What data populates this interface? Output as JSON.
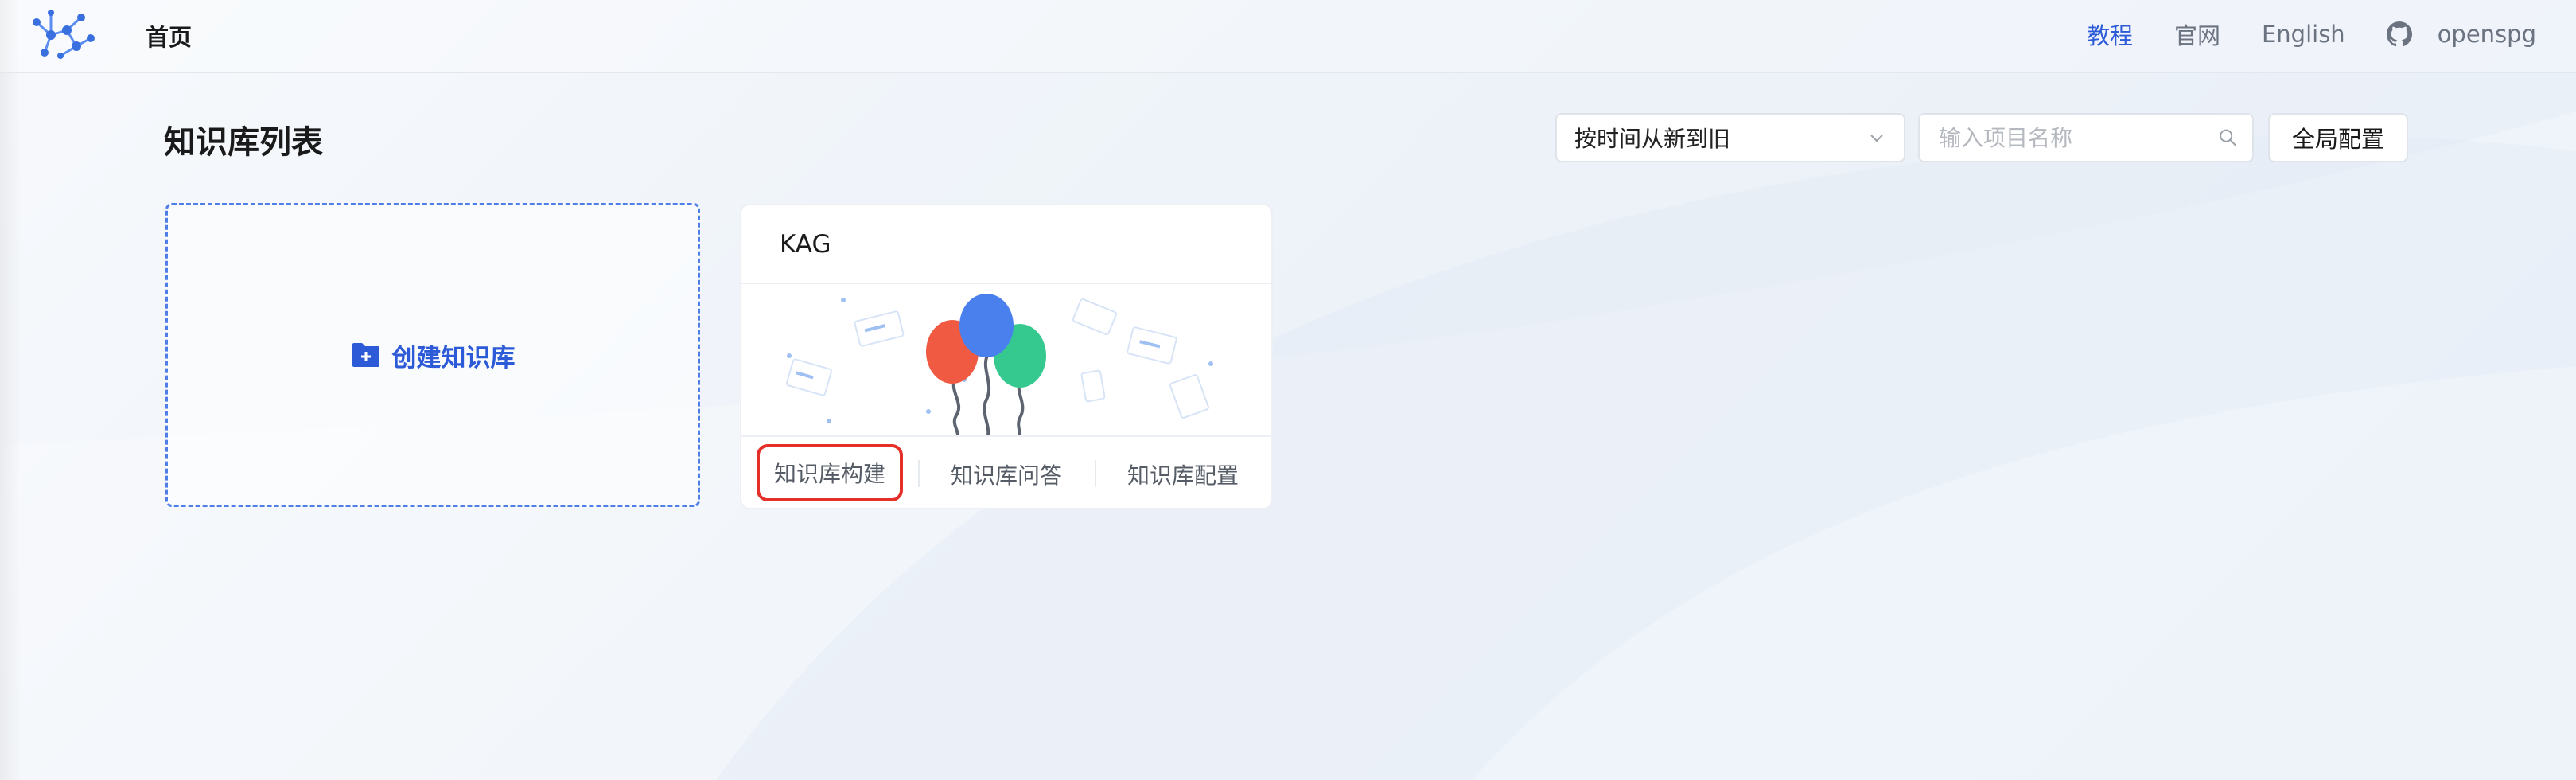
{
  "nav": {
    "home_label": "首页",
    "tutorial_label": "教程",
    "official_site_label": "官网",
    "language_label": "English",
    "openspg_label": "openspg"
  },
  "page": {
    "title": "知识库列表",
    "sort_value": "按时间从新到旧",
    "search_placeholder": "输入项目名称",
    "global_config_label": "全局配置"
  },
  "create_card": {
    "label": "创建知识库"
  },
  "kb_cards": [
    {
      "name": "KAG",
      "actions": [
        "知识库构建",
        "知识库问答",
        "知识库配置"
      ]
    }
  ],
  "colors": {
    "accent": "#2d5bd8",
    "highlight_border": "#e5302a",
    "balloon_red": "#f05a43",
    "balloon_blue": "#4a80ee",
    "balloon_green": "#35c98f"
  },
  "icons": {
    "logo": "graph-logo-icon",
    "github": "github-icon",
    "chevron": "chevron-down-icon",
    "search": "search-icon",
    "folder": "folder-add-icon"
  }
}
